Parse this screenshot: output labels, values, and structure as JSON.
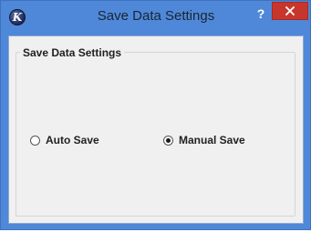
{
  "window": {
    "title": "Save Data Settings",
    "help_label": "?",
    "app_icon_letter": "K"
  },
  "group": {
    "title": "Save Data Settings"
  },
  "options": [
    {
      "label": "Auto Save",
      "checked": false
    },
    {
      "label": "Manual Save",
      "checked": true
    }
  ],
  "colors": {
    "titlebar": "#4f88d8",
    "close_button": "#c7362c",
    "client_background": "#f0f0f0"
  },
  "icons": {
    "app": "app-logo-icon",
    "help": "help-icon",
    "close": "close-icon"
  }
}
